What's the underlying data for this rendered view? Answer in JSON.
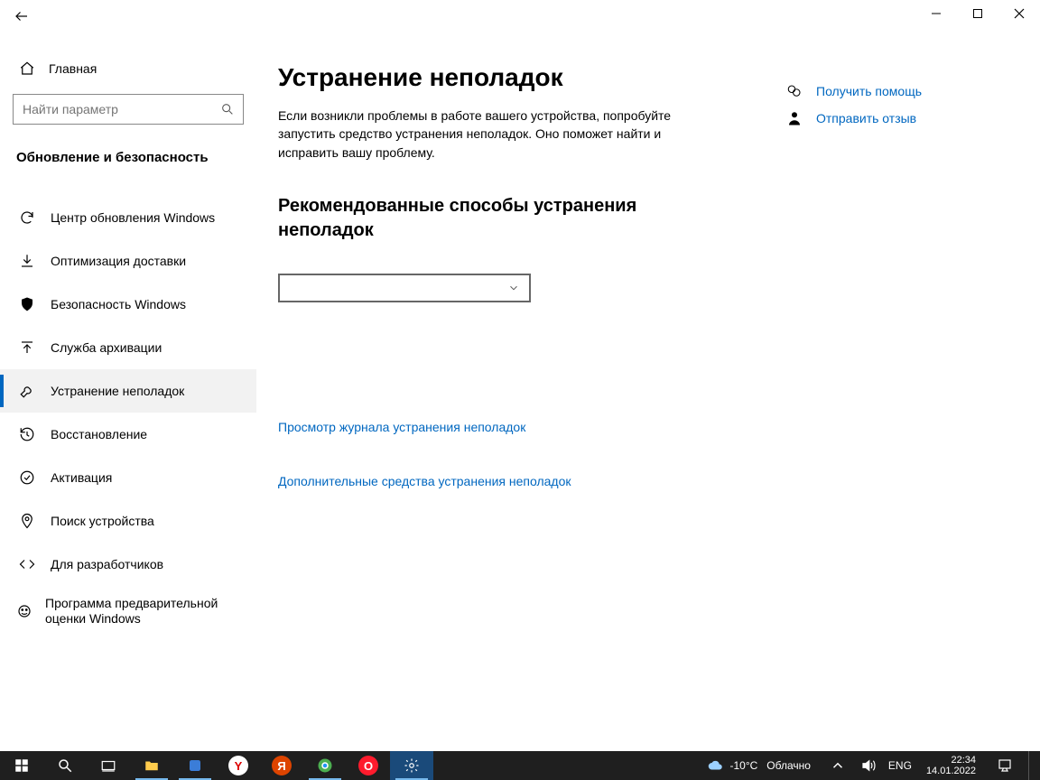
{
  "titlebar": {},
  "home_label": "Главная",
  "search_placeholder": "Найти параметр",
  "section_title": "Обновление и безопасность",
  "nav": [
    {
      "label": "Центр обновления Windows"
    },
    {
      "label": "Оптимизация доставки"
    },
    {
      "label": "Безопасность Windows"
    },
    {
      "label": "Служба архивации"
    },
    {
      "label": "Устранение неполадок"
    },
    {
      "label": "Восстановление"
    },
    {
      "label": "Активация"
    },
    {
      "label": "Поиск устройства"
    },
    {
      "label": "Для разработчиков"
    },
    {
      "label": "Программа предварительной оценки Windows"
    }
  ],
  "page": {
    "title": "Устранение неполадок",
    "desc": "Если возникли проблемы в работе вашего устройства, попробуйте запустить средство устранения неполадок. Оно поможет найти и исправить вашу проблему.",
    "subheading": "Рекомендованные способы устранения неполадок",
    "history_link": "Просмотр журнала устранения неполадок",
    "more_link": "Дополнительные средства устранения неполадок"
  },
  "help": {
    "get_help": "Получить помощь",
    "feedback": "Отправить отзыв"
  },
  "taskbar": {
    "weather_temp": "-10°C",
    "weather_cond": "Облачно",
    "lang": "ENG",
    "time": "22:34",
    "date": "14.01.2022"
  }
}
